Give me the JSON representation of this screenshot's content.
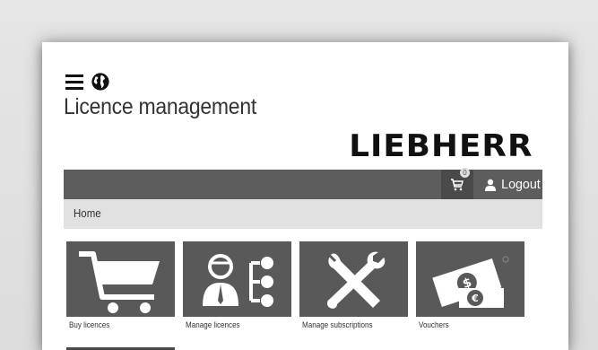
{
  "header": {
    "title": "Licence management",
    "brand": "LIEBHERR",
    "menu_icon": "hamburger-menu-icon",
    "language_icon": "globe-icon"
  },
  "navbar": {
    "cart_count": "0",
    "cart_icon": "shopping-cart-icon",
    "logout_label": "Logout",
    "user_icon": "user-icon"
  },
  "breadcrumb": {
    "home": "Home"
  },
  "tiles": [
    {
      "label": "Buy licences",
      "icon": "shopping-cart-icon"
    },
    {
      "label": "Manage licences",
      "icon": "person-hierarchy-icon"
    },
    {
      "label": "Manage subscriptions",
      "icon": "tools-icon"
    },
    {
      "label": "Vouchers",
      "icon": "money-icon"
    }
  ],
  "colors": {
    "navbar": "#5d5d5d",
    "tile": "#595959",
    "breadcrumb_bg": "#e1e1e1"
  }
}
